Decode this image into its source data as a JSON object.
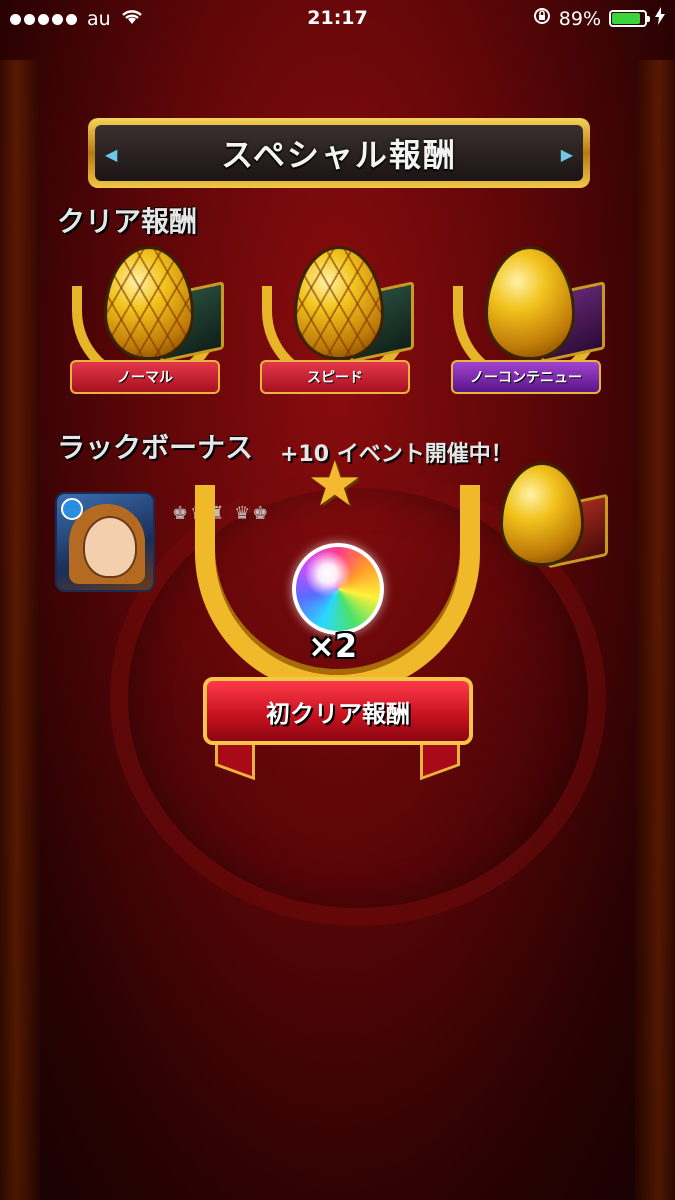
{
  "statusbar": {
    "carrier": "au",
    "time": "21:17",
    "battery_percent": "89%",
    "battery_level": 0.89,
    "icons": [
      "signal-dots-icon",
      "wifi-icon",
      "rotation-lock-icon",
      "battery-icon",
      "charging-bolt-icon"
    ]
  },
  "header": {
    "title": "スペシャル報酬"
  },
  "clear_rewards": {
    "label": "クリア報酬",
    "items": [
      {
        "label": "ノーマル",
        "color": "#c4101e"
      },
      {
        "label": "スピード",
        "color": "#c4101e"
      },
      {
        "label": "ノーコンテニュー",
        "color": "#7a1ea8"
      }
    ]
  },
  "luck_bonus": {
    "label": "ラックボーナス",
    "event_text": "+10 イベント開催中！"
  },
  "first_clear_award": {
    "count": "×2",
    "banner": "初クリア報酬"
  },
  "colors": {
    "accent_gold": "#f0b92a",
    "background_red": "#5e0608"
  }
}
